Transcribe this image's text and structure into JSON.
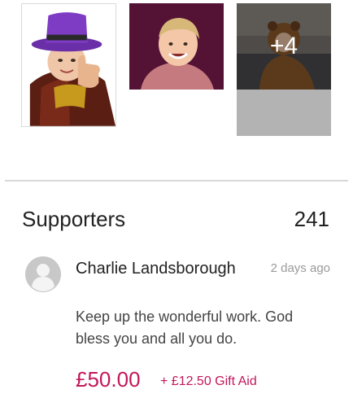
{
  "gallery": {
    "more_count_label": "+4"
  },
  "supporters": {
    "title": "Supporters",
    "count": "241",
    "items": [
      {
        "name": "Charlie Landsborough",
        "time": "2 days ago",
        "message": "Keep up the wonderful work. God bless you and all you do.",
        "amount": "£50.00",
        "gift_aid": "+ £12.50 Gift Aid"
      }
    ]
  },
  "colors": {
    "accent": "#c2185b",
    "muted_text": "#9a9a9a",
    "divider": "#d8d8d8"
  },
  "icons": {
    "avatar": "person-placeholder-icon"
  }
}
